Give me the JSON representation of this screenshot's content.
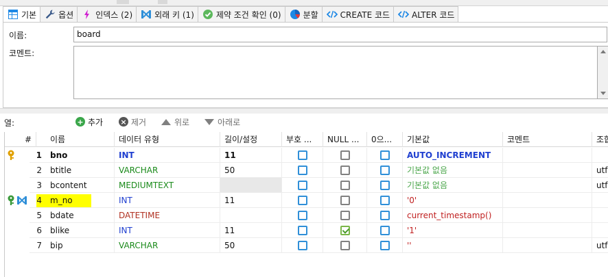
{
  "colors": {
    "accent_blue": "#2f8fd8",
    "type_int": "#1f3fd0",
    "type_varchar": "#1a8a1a",
    "type_datetime": "#b03020",
    "default_green": "#4aa64a",
    "default_red": "#c02020",
    "highlight": "#ffff00",
    "key_gold": "#e0a000",
    "key_green": "#3a9a3a"
  },
  "tabs": [
    {
      "label": "기본",
      "icon": "table-icon"
    },
    {
      "label": "옵션",
      "icon": "wrench-icon"
    },
    {
      "label": "인덱스 (2)",
      "icon": "lightning-icon"
    },
    {
      "label": "외래 키 (1)",
      "icon": "foreign-key-icon"
    },
    {
      "label": "제약 조건 확인 (0)",
      "icon": "check-icon"
    },
    {
      "label": "분할",
      "icon": "pie-icon"
    },
    {
      "label": "CREATE 코드",
      "icon": "code-icon"
    },
    {
      "label": "ALTER 코드",
      "icon": "code-icon"
    }
  ],
  "basic": {
    "name_label": "이름:",
    "name_value": "board",
    "comment_label": "코멘트:",
    "comment_value": ""
  },
  "columns_toolbar": {
    "label": "열:",
    "add": "추가",
    "remove": "제거",
    "up": "위로",
    "down": "아래로"
  },
  "grid": {
    "headers": [
      "#",
      "이름",
      "데이터 유형",
      "길이/설정",
      "부호 ...",
      "NULL ...",
      "0으...",
      "기본값",
      "코멘트",
      "조합"
    ],
    "rows": [
      {
        "num": "1",
        "name": "bno",
        "type": "INT",
        "length": "11",
        "unsigned": false,
        "allow_null": false,
        "zerofill": false,
        "default": "AUTO_INCREMENT",
        "comment": "",
        "collation": "",
        "key": "primary"
      },
      {
        "num": "2",
        "name": "btitle",
        "type": "VARCHAR",
        "length": "50",
        "unsigned": false,
        "allow_null": false,
        "zerofill": false,
        "default": "기본값 없음",
        "comment": "",
        "collation": "utf",
        "key": ""
      },
      {
        "num": "3",
        "name": "bcontent",
        "type": "MEDIUMTEXT",
        "length": "",
        "unsigned": false,
        "allow_null": false,
        "zerofill": false,
        "default": "기본값 없음",
        "comment": "",
        "collation": "utf",
        "key": ""
      },
      {
        "num": "4",
        "name": "m_no",
        "type": "INT",
        "length": "11",
        "unsigned": false,
        "allow_null": false,
        "zerofill": false,
        "default": "'0'",
        "comment": "",
        "collation": "",
        "key": "index-foreign"
      },
      {
        "num": "5",
        "name": "bdate",
        "type": "DATETIME",
        "length": "",
        "unsigned": false,
        "allow_null": false,
        "zerofill": false,
        "default": "current_timestamp()",
        "comment": "",
        "collation": "",
        "key": ""
      },
      {
        "num": "6",
        "name": "blike",
        "type": "INT",
        "length": "11",
        "unsigned": false,
        "allow_null": true,
        "zerofill": false,
        "default": "'1'",
        "comment": "",
        "collation": "",
        "key": ""
      },
      {
        "num": "7",
        "name": "bip",
        "type": "VARCHAR",
        "length": "50",
        "unsigned": false,
        "allow_null": false,
        "zerofill": false,
        "default": "''",
        "comment": "",
        "collation": "utf",
        "key": ""
      }
    ]
  }
}
